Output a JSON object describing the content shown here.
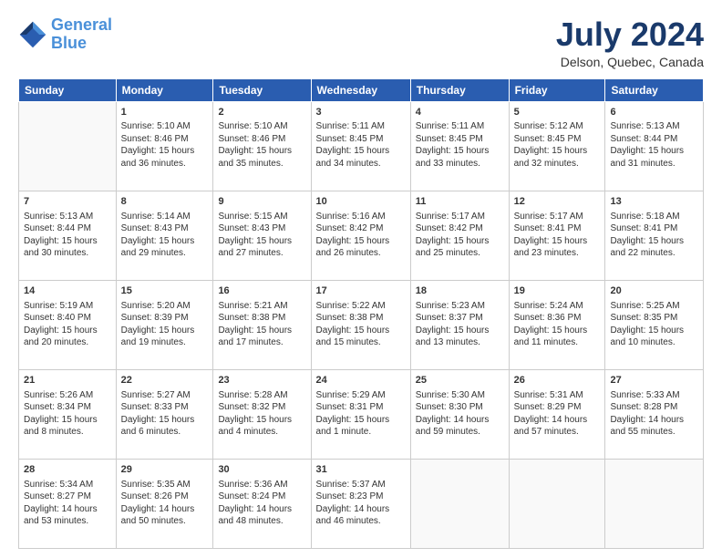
{
  "header": {
    "logo_line1": "General",
    "logo_line2": "Blue",
    "month": "July 2024",
    "location": "Delson, Quebec, Canada"
  },
  "weekdays": [
    "Sunday",
    "Monday",
    "Tuesday",
    "Wednesday",
    "Thursday",
    "Friday",
    "Saturday"
  ],
  "weeks": [
    [
      {
        "day": "",
        "info": ""
      },
      {
        "day": "1",
        "info": "Sunrise: 5:10 AM\nSunset: 8:46 PM\nDaylight: 15 hours\nand 36 minutes."
      },
      {
        "day": "2",
        "info": "Sunrise: 5:10 AM\nSunset: 8:46 PM\nDaylight: 15 hours\nand 35 minutes."
      },
      {
        "day": "3",
        "info": "Sunrise: 5:11 AM\nSunset: 8:45 PM\nDaylight: 15 hours\nand 34 minutes."
      },
      {
        "day": "4",
        "info": "Sunrise: 5:11 AM\nSunset: 8:45 PM\nDaylight: 15 hours\nand 33 minutes."
      },
      {
        "day": "5",
        "info": "Sunrise: 5:12 AM\nSunset: 8:45 PM\nDaylight: 15 hours\nand 32 minutes."
      },
      {
        "day": "6",
        "info": "Sunrise: 5:13 AM\nSunset: 8:44 PM\nDaylight: 15 hours\nand 31 minutes."
      }
    ],
    [
      {
        "day": "7",
        "info": "Sunrise: 5:13 AM\nSunset: 8:44 PM\nDaylight: 15 hours\nand 30 minutes."
      },
      {
        "day": "8",
        "info": "Sunrise: 5:14 AM\nSunset: 8:43 PM\nDaylight: 15 hours\nand 29 minutes."
      },
      {
        "day": "9",
        "info": "Sunrise: 5:15 AM\nSunset: 8:43 PM\nDaylight: 15 hours\nand 27 minutes."
      },
      {
        "day": "10",
        "info": "Sunrise: 5:16 AM\nSunset: 8:42 PM\nDaylight: 15 hours\nand 26 minutes."
      },
      {
        "day": "11",
        "info": "Sunrise: 5:17 AM\nSunset: 8:42 PM\nDaylight: 15 hours\nand 25 minutes."
      },
      {
        "day": "12",
        "info": "Sunrise: 5:17 AM\nSunset: 8:41 PM\nDaylight: 15 hours\nand 23 minutes."
      },
      {
        "day": "13",
        "info": "Sunrise: 5:18 AM\nSunset: 8:41 PM\nDaylight: 15 hours\nand 22 minutes."
      }
    ],
    [
      {
        "day": "14",
        "info": "Sunrise: 5:19 AM\nSunset: 8:40 PM\nDaylight: 15 hours\nand 20 minutes."
      },
      {
        "day": "15",
        "info": "Sunrise: 5:20 AM\nSunset: 8:39 PM\nDaylight: 15 hours\nand 19 minutes."
      },
      {
        "day": "16",
        "info": "Sunrise: 5:21 AM\nSunset: 8:38 PM\nDaylight: 15 hours\nand 17 minutes."
      },
      {
        "day": "17",
        "info": "Sunrise: 5:22 AM\nSunset: 8:38 PM\nDaylight: 15 hours\nand 15 minutes."
      },
      {
        "day": "18",
        "info": "Sunrise: 5:23 AM\nSunset: 8:37 PM\nDaylight: 15 hours\nand 13 minutes."
      },
      {
        "day": "19",
        "info": "Sunrise: 5:24 AM\nSunset: 8:36 PM\nDaylight: 15 hours\nand 11 minutes."
      },
      {
        "day": "20",
        "info": "Sunrise: 5:25 AM\nSunset: 8:35 PM\nDaylight: 15 hours\nand 10 minutes."
      }
    ],
    [
      {
        "day": "21",
        "info": "Sunrise: 5:26 AM\nSunset: 8:34 PM\nDaylight: 15 hours\nand 8 minutes."
      },
      {
        "day": "22",
        "info": "Sunrise: 5:27 AM\nSunset: 8:33 PM\nDaylight: 15 hours\nand 6 minutes."
      },
      {
        "day": "23",
        "info": "Sunrise: 5:28 AM\nSunset: 8:32 PM\nDaylight: 15 hours\nand 4 minutes."
      },
      {
        "day": "24",
        "info": "Sunrise: 5:29 AM\nSunset: 8:31 PM\nDaylight: 15 hours\nand 1 minute."
      },
      {
        "day": "25",
        "info": "Sunrise: 5:30 AM\nSunset: 8:30 PM\nDaylight: 14 hours\nand 59 minutes."
      },
      {
        "day": "26",
        "info": "Sunrise: 5:31 AM\nSunset: 8:29 PM\nDaylight: 14 hours\nand 57 minutes."
      },
      {
        "day": "27",
        "info": "Sunrise: 5:33 AM\nSunset: 8:28 PM\nDaylight: 14 hours\nand 55 minutes."
      }
    ],
    [
      {
        "day": "28",
        "info": "Sunrise: 5:34 AM\nSunset: 8:27 PM\nDaylight: 14 hours\nand 53 minutes."
      },
      {
        "day": "29",
        "info": "Sunrise: 5:35 AM\nSunset: 8:26 PM\nDaylight: 14 hours\nand 50 minutes."
      },
      {
        "day": "30",
        "info": "Sunrise: 5:36 AM\nSunset: 8:24 PM\nDaylight: 14 hours\nand 48 minutes."
      },
      {
        "day": "31",
        "info": "Sunrise: 5:37 AM\nSunset: 8:23 PM\nDaylight: 14 hours\nand 46 minutes."
      },
      {
        "day": "",
        "info": ""
      },
      {
        "day": "",
        "info": ""
      },
      {
        "day": "",
        "info": ""
      }
    ]
  ]
}
